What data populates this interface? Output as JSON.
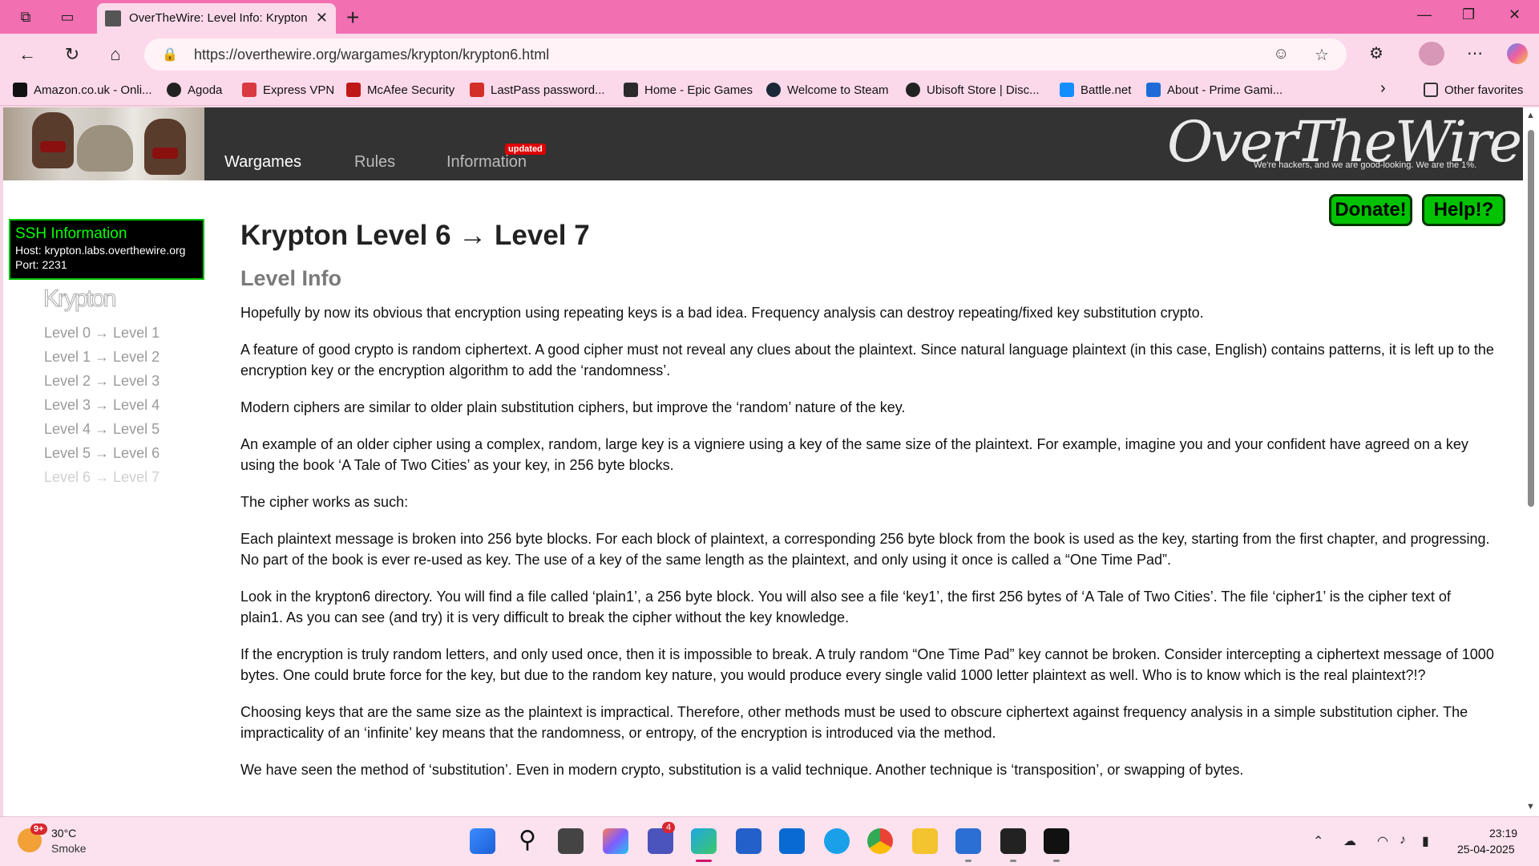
{
  "browser": {
    "tab_title": "OverTheWire: Level Info: Krypton",
    "url": "https://overthewire.org/wargames/krypton/krypton6.html",
    "favorites": [
      {
        "label": "Amazon.co.uk - Onli...",
        "color": "#111111"
      },
      {
        "label": "Agoda",
        "color": "#222222"
      },
      {
        "label": "Express VPN",
        "color": "#da3940"
      },
      {
        "label": "McAfee Security",
        "color": "#c01818"
      },
      {
        "label": "LastPass password...",
        "color": "#d32d27"
      },
      {
        "label": "Home - Epic Games",
        "color": "#2a2a2a"
      },
      {
        "label": "Welcome to Steam",
        "color": "#1b2838"
      },
      {
        "label": "Ubisoft Store | Disc...",
        "color": "#222222"
      },
      {
        "label": "Battle.net",
        "color": "#148eff"
      },
      {
        "label": "About - Prime Gami...",
        "color": "#1e6bd8"
      }
    ],
    "other_favorites": "Other favorites"
  },
  "site": {
    "nav": {
      "wargames": "Wargames",
      "rules": "Rules",
      "information": "Information",
      "updated": "updated"
    },
    "logo": "OverTheWire",
    "tagline": "We're hackers, and we are good-looking. We are the 1%.",
    "donate": "Donate!",
    "help": "Help!?"
  },
  "sidebar": {
    "ssh_title": "SSH Information",
    "host": "Host: krypton.labs.overthewire.org",
    "port": "Port: 2231",
    "game_title": "Krypton",
    "levels": [
      "Level 0 → Level 1",
      "Level 1 → Level 2",
      "Level 2 → Level 3",
      "Level 3 → Level 4",
      "Level 4 → Level 5",
      "Level 5 → Level 6",
      "Level 6 → Level 7"
    ]
  },
  "content": {
    "title": "Krypton Level 6 → Level 7",
    "subtitle": "Level Info",
    "paragraphs": [
      "Hopefully by now its obvious that encryption using repeating keys is a bad idea. Frequency analysis can destroy repeating/fixed key substitution crypto.",
      "A feature of good crypto is random ciphertext. A good cipher must not reveal any clues about the plaintext. Since natural language plaintext (in this case, English) contains patterns, it is left up to the encryption key or the encryption algorithm to add the ‘randomness’.",
      "Modern ciphers are similar to older plain substitution ciphers, but improve the ‘random’ nature of the key.",
      "An example of an older cipher using a complex, random, large key is a vigniere using a key of the same size of the plaintext. For example, imagine you and your confident have agreed on a key using the book ‘A Tale of Two Cities’ as your key, in 256 byte blocks.",
      "The cipher works as such:",
      "Each plaintext message is broken into 256 byte blocks. For each block of plaintext, a corresponding 256 byte block from the book is used as the key, starting from the first chapter, and progressing. No part of the book is ever re-used as key. The use of a key of the same length as the plaintext, and only using it once is called a “One Time Pad”.",
      "Look in the krypton6 directory. You will find a file called ‘plain1’, a 256 byte block. You will also see a file ‘key1’, the first 256 bytes of ‘A Tale of Two Cities’. The file ‘cipher1’ is the cipher text of plain1. As you can see (and try) it is very difficult to break the cipher without the key knowledge.",
      "If the encryption is truly random letters, and only used once, then it is impossible to break. A truly random “One Time Pad” key cannot be broken. Consider intercepting a ciphertext message of 1000 bytes. One could brute force for the key, but due to the random key nature, you would produce every single valid 1000 letter plaintext as well. Who is to know which is the real plaintext?!?",
      "Choosing keys that are the same size as the plaintext is impractical. Therefore, other methods must be used to obscure ciphertext against frequency analysis in a simple substitution cipher. The impracticality of an ‘infinite’ key means that the randomness, or entropy, of the encryption is introduced via the method.",
      "We have seen the method of ‘substitution’. Even in modern crypto, substitution is a valid technique. Another technique is ‘transposition’, or swapping of bytes."
    ]
  },
  "taskbar": {
    "weather_badge": "9+",
    "temperature": "30°C",
    "condition": "Smoke",
    "teams_badge": "4",
    "time": "23:19",
    "date": "25-04-2025"
  }
}
